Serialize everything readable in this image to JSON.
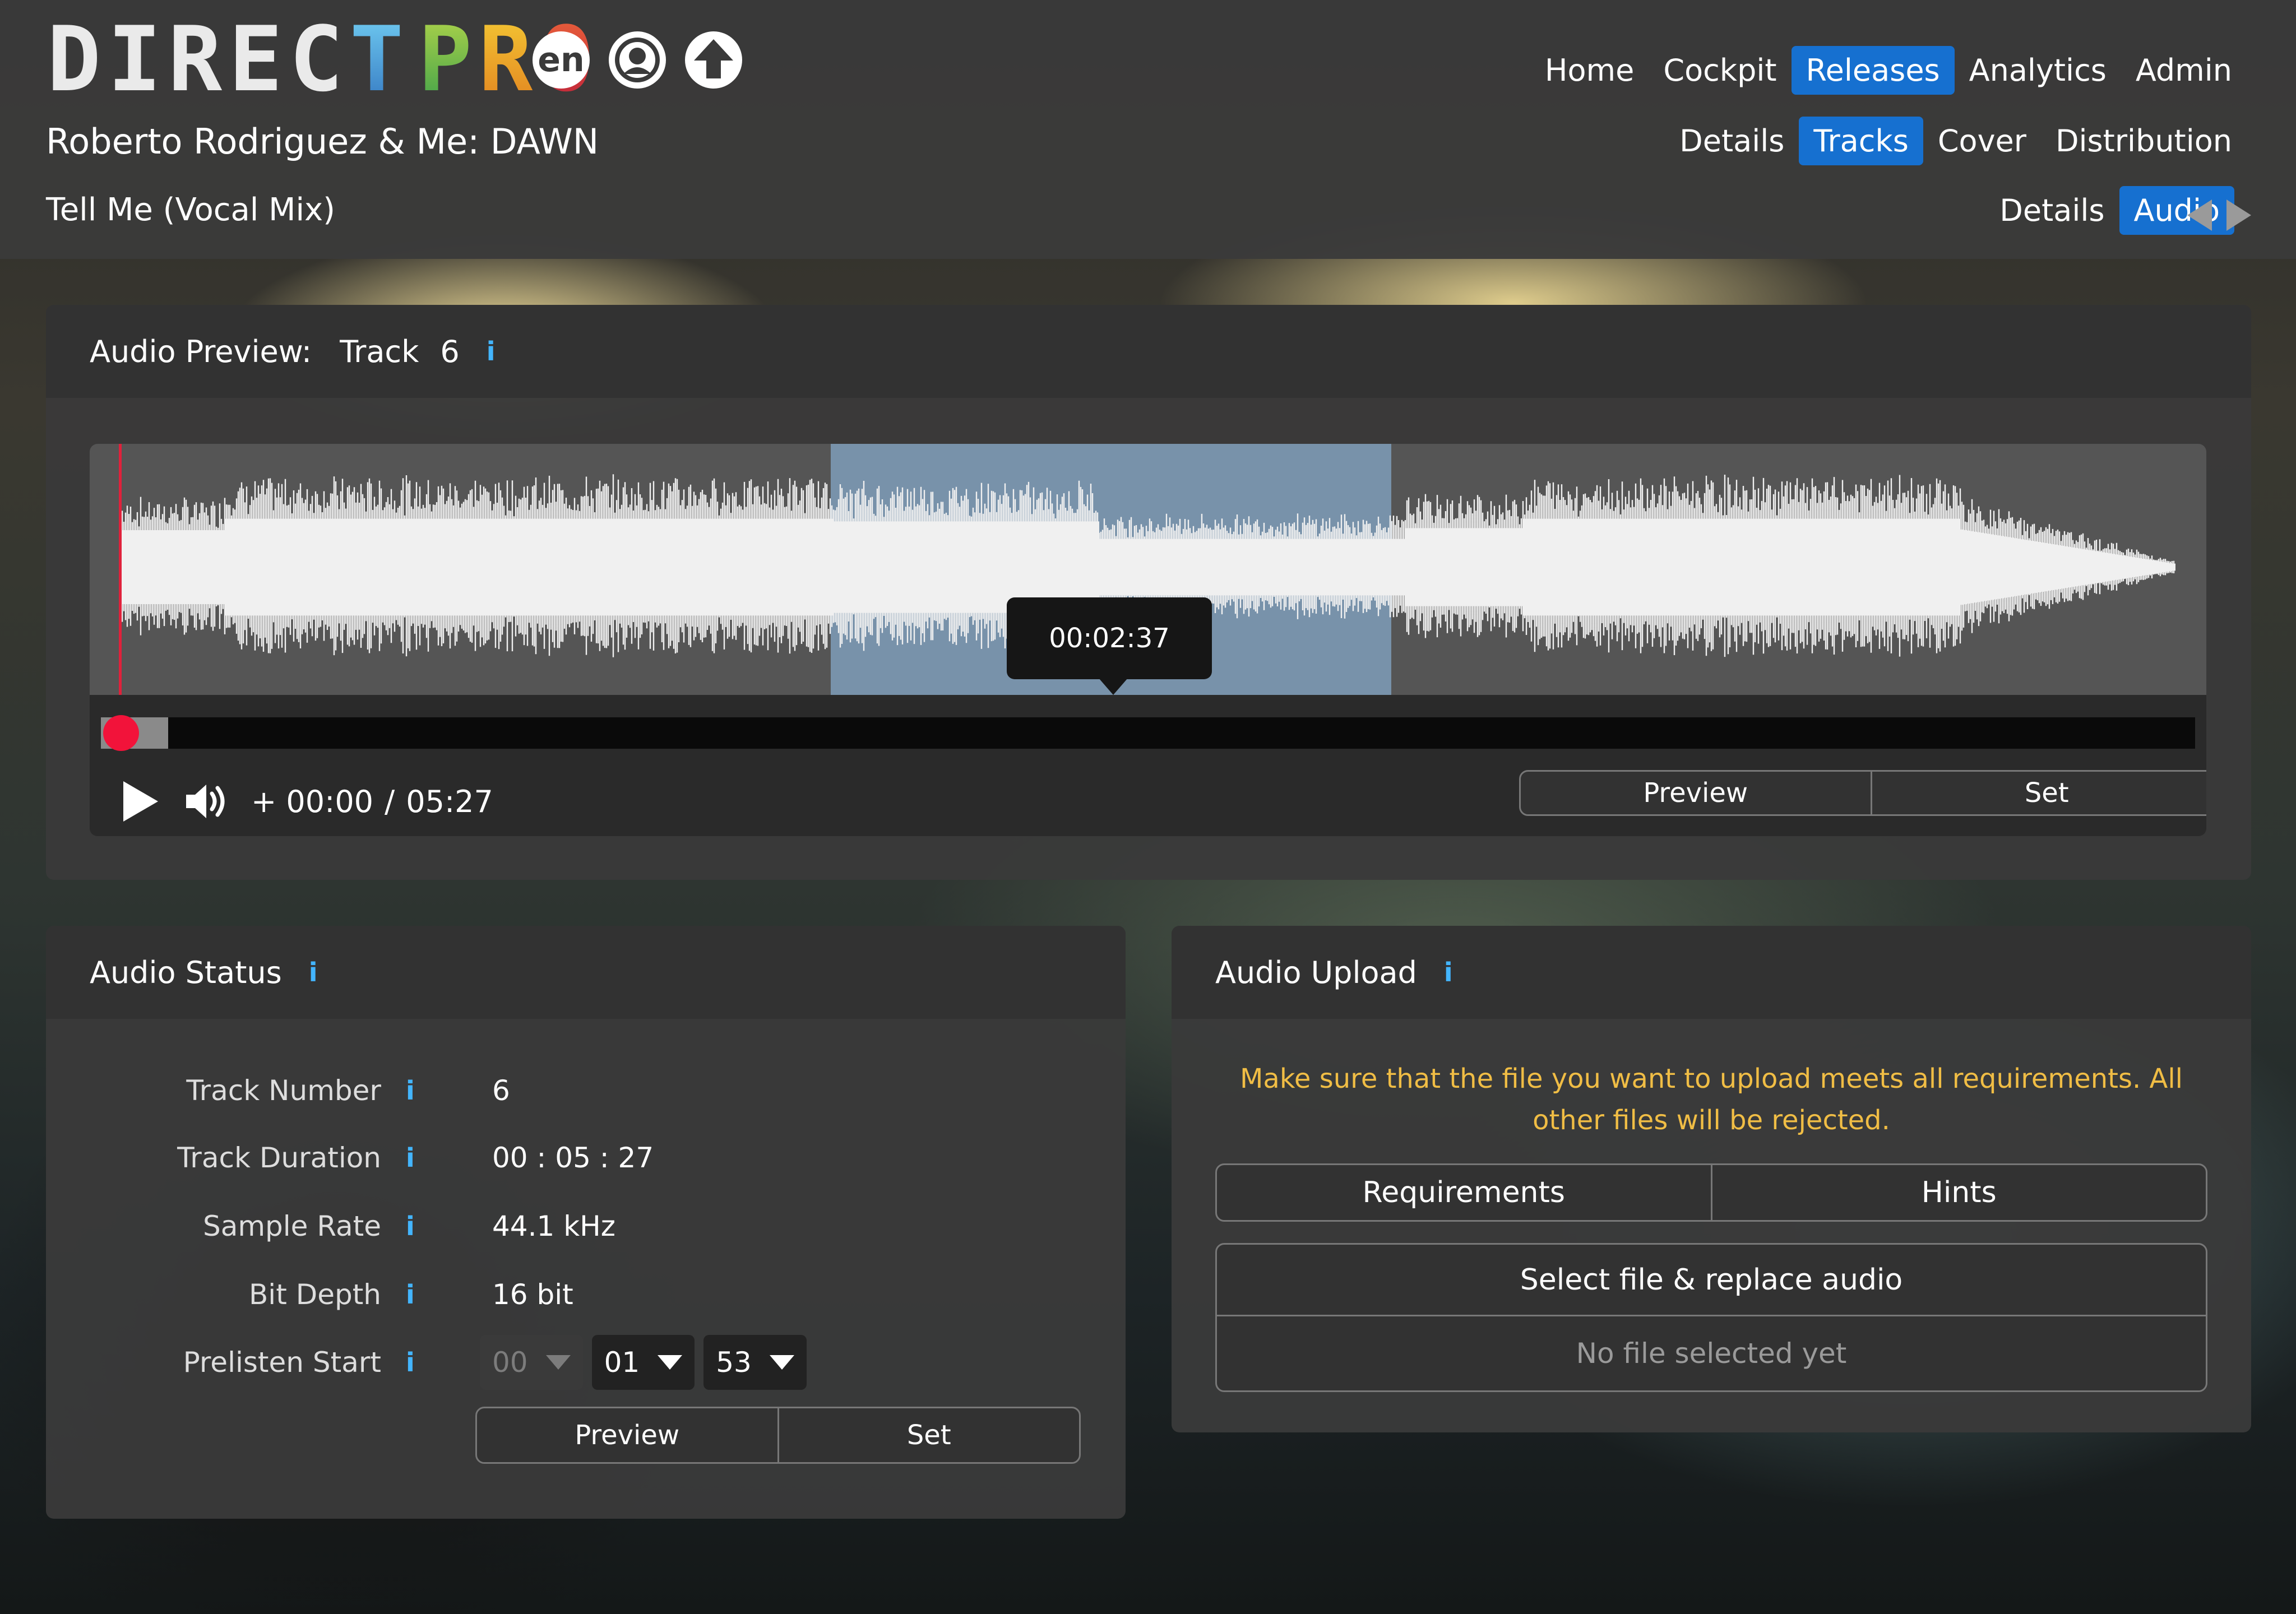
{
  "logo": {
    "text": "DIRECT PRO",
    "letters": [
      "D",
      "I",
      "R",
      "E",
      "C",
      "T",
      "P",
      "R",
      "O"
    ]
  },
  "header": {
    "language": "en",
    "release_title": "Roberto Rodriguez & Me: DAWN",
    "track_title": "Tell Me (Vocal Mix)"
  },
  "nav": {
    "main": [
      "Home",
      "Cockpit",
      "Releases",
      "Analytics",
      "Admin"
    ],
    "main_active": "Releases",
    "release": [
      "Details",
      "Tracks",
      "Cover",
      "Distribution"
    ],
    "release_active": "Tracks",
    "track": [
      "Details",
      "Audio"
    ],
    "track_active": "Audio"
  },
  "preview": {
    "title": "Audio Preview:",
    "track_label": "Track",
    "track_number": "6",
    "info": "i",
    "tooltip_time": "00:02:37",
    "time_current": "+ 00:00",
    "time_separator": "/",
    "time_total": "05:27",
    "position_fraction": 0.0,
    "buffered_fraction": 0.03,
    "selection_start_fraction": 0.35,
    "selection_end_fraction": 0.615,
    "preview_label": "Preview",
    "set_label": "Set"
  },
  "status": {
    "title": "Audio Status",
    "info": "i",
    "rows": [
      {
        "label": "Track Number",
        "value": "6"
      },
      {
        "label": "Track Duration",
        "value": "00 : 05 : 27"
      },
      {
        "label": "Sample Rate",
        "value": "44.1 kHz"
      },
      {
        "label": "Bit Depth",
        "value": "16 bit"
      }
    ],
    "prelisten_label": "Prelisten Start",
    "prelisten_hours": "00",
    "prelisten_minutes": "01",
    "prelisten_seconds": "53",
    "preview_label": "Preview",
    "set_label": "Set"
  },
  "upload": {
    "title": "Audio Upload",
    "info": "i",
    "warning": "Make sure that the file you want to upload meets all requirements. All other files will be rejected.",
    "requirements_label": "Requirements",
    "hints_label": "Hints",
    "select_label": "Select file & replace audio",
    "no_file_label": "No file selected yet"
  },
  "colors": {
    "accent": "#1670d0",
    "info": "#43b5ff",
    "warning": "#f0bd45",
    "playhead": "#e0213b",
    "waveform": "#f0f0f0",
    "selection": "#96c4f0"
  }
}
